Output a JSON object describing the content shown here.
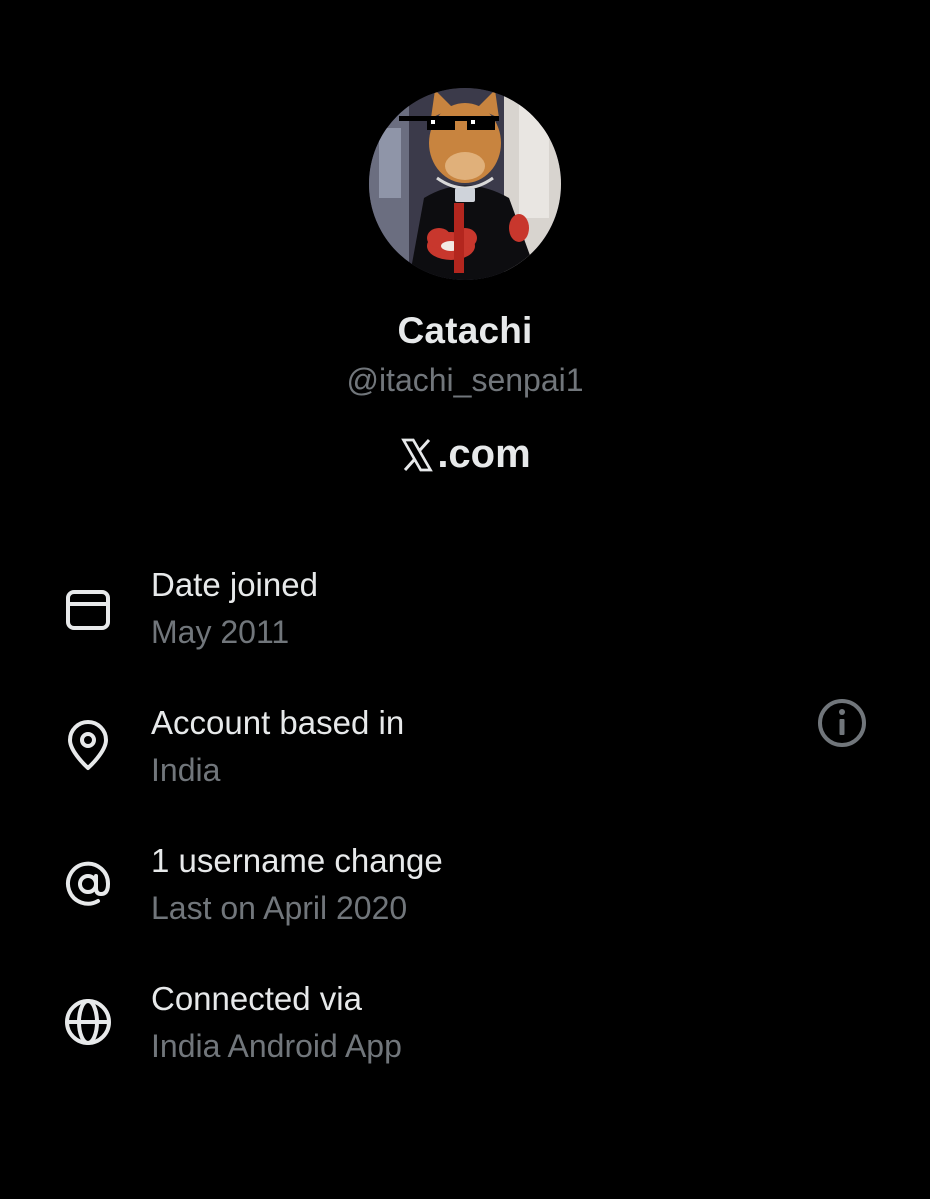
{
  "profile": {
    "display_name": "Catachi",
    "handle": "@itachi_senpai1",
    "site_text": ".com",
    "site_logo": "x-logo-icon"
  },
  "about": {
    "rows": [
      {
        "icon": "calendar-icon",
        "title": "Date joined",
        "value": "May 2011"
      },
      {
        "icon": "location-pin-icon",
        "title": "Account based in",
        "value": "India"
      },
      {
        "icon": "at-sign-icon",
        "title": "1 username change",
        "value": "Last on April 2020"
      },
      {
        "icon": "globe-icon",
        "title": "Connected via",
        "value": "India Android App"
      }
    ],
    "info_icon": "info-icon"
  },
  "colors": {
    "background": "#000000",
    "primary_text": "#e7e9ea",
    "secondary_text": "#71767b"
  }
}
